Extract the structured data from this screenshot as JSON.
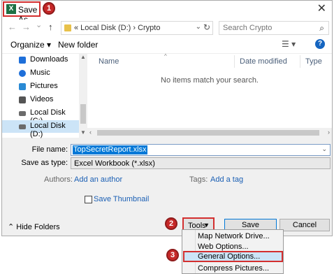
{
  "window": {
    "title": "Save As",
    "close_glyph": "✕"
  },
  "markers": [
    "1",
    "2",
    "3"
  ],
  "navigation": {
    "back_glyph": "←",
    "forward_glyph": "→",
    "recent_glyph": "⌄",
    "up_glyph": "↑",
    "address_path": "«  Local Disk (D:)  ›  Crypto",
    "search_placeholder": "Search Crypto"
  },
  "toolbar": {
    "organize_label": "Organize ▾",
    "new_folder_label": "New folder"
  },
  "sidebar": {
    "items": [
      {
        "label": "Downloads",
        "icon": "download-icon",
        "color": "#1e6fd9"
      },
      {
        "label": "Music",
        "icon": "music-icon",
        "color": "#1e6fd9"
      },
      {
        "label": "Pictures",
        "icon": "pictures-icon",
        "color": "#2a8ad4"
      },
      {
        "label": "Videos",
        "icon": "videos-icon",
        "color": "#555555"
      },
      {
        "label": "Local Disk (C:)",
        "icon": "drive-icon",
        "color": "#6b6b6b"
      },
      {
        "label": "Local Disk (D:)",
        "icon": "drive-icon",
        "color": "#6b6b6b",
        "selected": true
      }
    ]
  },
  "file_list": {
    "columns": [
      "Name",
      "Date modified",
      "Type"
    ],
    "empty_message": "No items match your search."
  },
  "form": {
    "file_name_label": "File name:",
    "file_name_value": "TopSecretReport.xlsx",
    "save_type_label": "Save as type:",
    "save_type_value": "Excel Workbook (*.xlsx)",
    "authors_label": "Authors:",
    "authors_link": "Add an author",
    "tags_label": "Tags:",
    "tags_link": "Add a tag",
    "thumbnail_label": "Save Thumbnail"
  },
  "footer": {
    "hide_folders_label": "Hide Folders",
    "tools_label": "Tools",
    "save_label": "Save",
    "cancel_label": "Cancel"
  },
  "tools_menu": {
    "items": [
      "Map Network Drive...",
      "Web Options...",
      "General Options...",
      "Compress Pictures..."
    ],
    "highlighted_index": 2
  },
  "colors": {
    "highlight_border": "#d32f2f",
    "selection": "#0078d7"
  }
}
